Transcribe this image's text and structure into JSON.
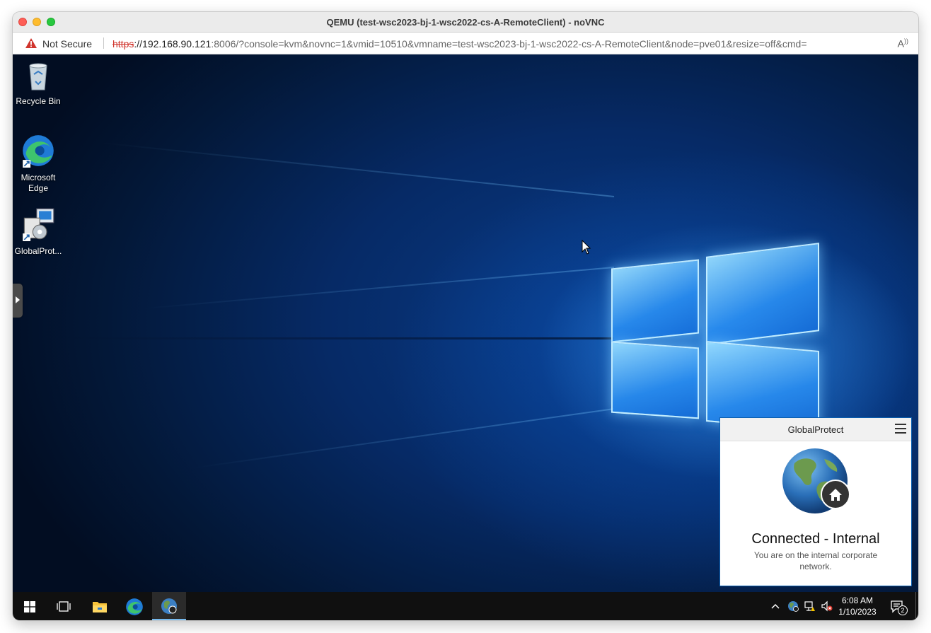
{
  "window": {
    "title": "QEMU (test-wsc2023-bj-1-wsc2022-cs-A-RemoteClient) - noVNC"
  },
  "address_bar": {
    "security_label": "Not Secure",
    "url_scheme": "https",
    "url_host": "://192.168.90.121",
    "url_rest": ":8006/?console=kvm&novnc=1&vmid=10510&vmname=test-wsc2023-bj-1-wsc2022-cs-A-RemoteClient&node=pve01&resize=off&cmd=",
    "reader_icon": "read-aloud-icon"
  },
  "desktop": {
    "icons": [
      {
        "label": "Recycle Bin",
        "icon": "recycle-bin-icon"
      },
      {
        "label": "Microsoft Edge",
        "icon": "edge-icon"
      },
      {
        "label": "GlobalProt...",
        "icon": "installer-icon"
      }
    ]
  },
  "globalprotect": {
    "title": "GlobalProtect",
    "status": "Connected - Internal",
    "description": "You are on the internal corporate network."
  },
  "taskbar": {
    "buttons": [
      "start-icon",
      "task-view-icon",
      "file-explorer-icon",
      "edge-icon",
      "globalprotect-icon"
    ],
    "tray_icons": [
      "chevron-up-icon",
      "globalprotect-tray-icon",
      "network-icon",
      "volume-muted-icon"
    ],
    "time": "6:08 AM",
    "date": "1/10/2023",
    "notification_count": "2"
  },
  "colors": {
    "accent": "#76b9ed",
    "desktop_bg": "#062a66",
    "warning": "#d0342c"
  }
}
